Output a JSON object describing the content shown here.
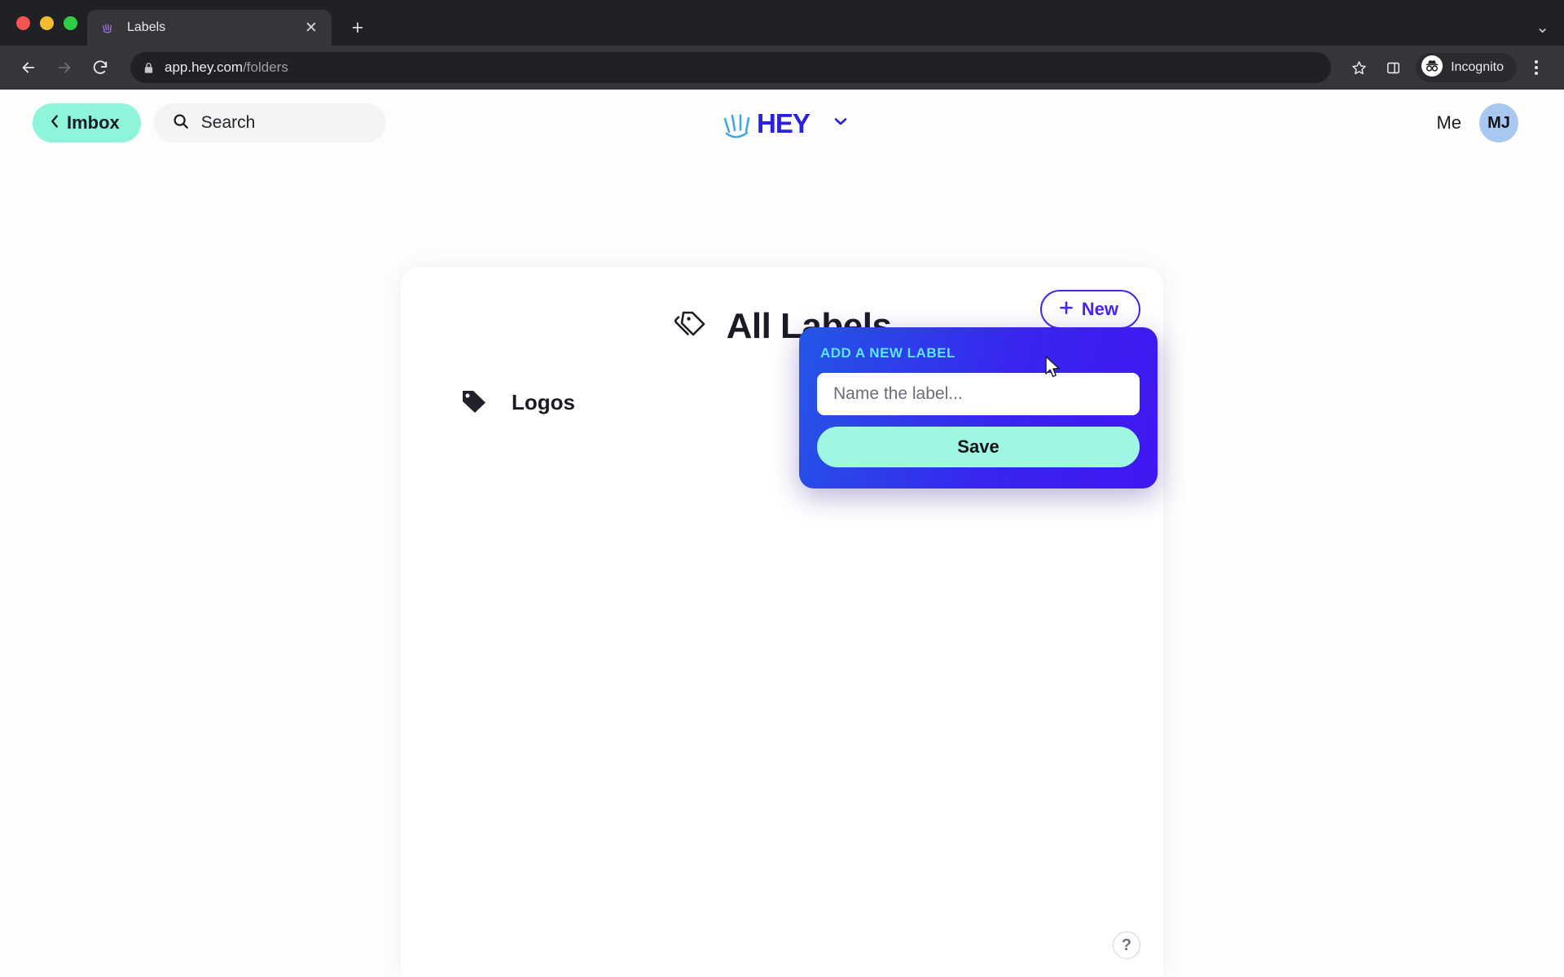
{
  "browser": {
    "tab": {
      "title": "Labels",
      "favicon_icon": "hey-hand-favicon",
      "close_icon": "close-icon"
    },
    "new_tab_icon": "plus-icon",
    "tab_list_icon": "chevron-down-icon",
    "back_icon": "arrow-left-icon",
    "forward_icon": "arrow-right-icon",
    "reload_icon": "reload-icon",
    "lock_icon": "lock-icon",
    "url_host": "app.hey.com",
    "url_path": "/folders",
    "bookmark_icon": "star-icon",
    "side_panel_icon": "side-panel-icon",
    "incognito_icon": "incognito-icon",
    "incognito_label": "Incognito",
    "menu_icon": "three-dots-icon",
    "traffic_lights": [
      "close",
      "minimize",
      "maximize"
    ]
  },
  "app": {
    "header": {
      "back_icon": "chevron-left-icon",
      "imbox_label": "Imbox",
      "search_icon": "search-icon",
      "search_placeholder": "Search",
      "logo_name": "hey-logo",
      "logo_text": "HEY",
      "logo_chevron_icon": "chevron-down-icon",
      "me_label": "Me",
      "avatar_initials": "MJ"
    },
    "main": {
      "new_button_label": "New",
      "new_button_icon": "plus-icon",
      "title_icon": "tags-icon",
      "title": "All Labels",
      "labels": [
        {
          "icon": "tag-icon",
          "name": "Logos"
        }
      ]
    },
    "popover": {
      "title": "ADD A NEW LABEL",
      "input_value": "",
      "input_placeholder": "Name the label...",
      "save_label": "Save"
    },
    "help_label": "?",
    "colors": {
      "imbox_mint": "#8ef5da",
      "save_mint": "#9ef7e2",
      "accent_purple": "#4724f0",
      "popover_gradient_start": "#2357e6",
      "popover_gradient_end": "#4117f2",
      "popover_title_cyan": "#5ee4fb",
      "avatar_blue": "#a8c8f0"
    }
  }
}
